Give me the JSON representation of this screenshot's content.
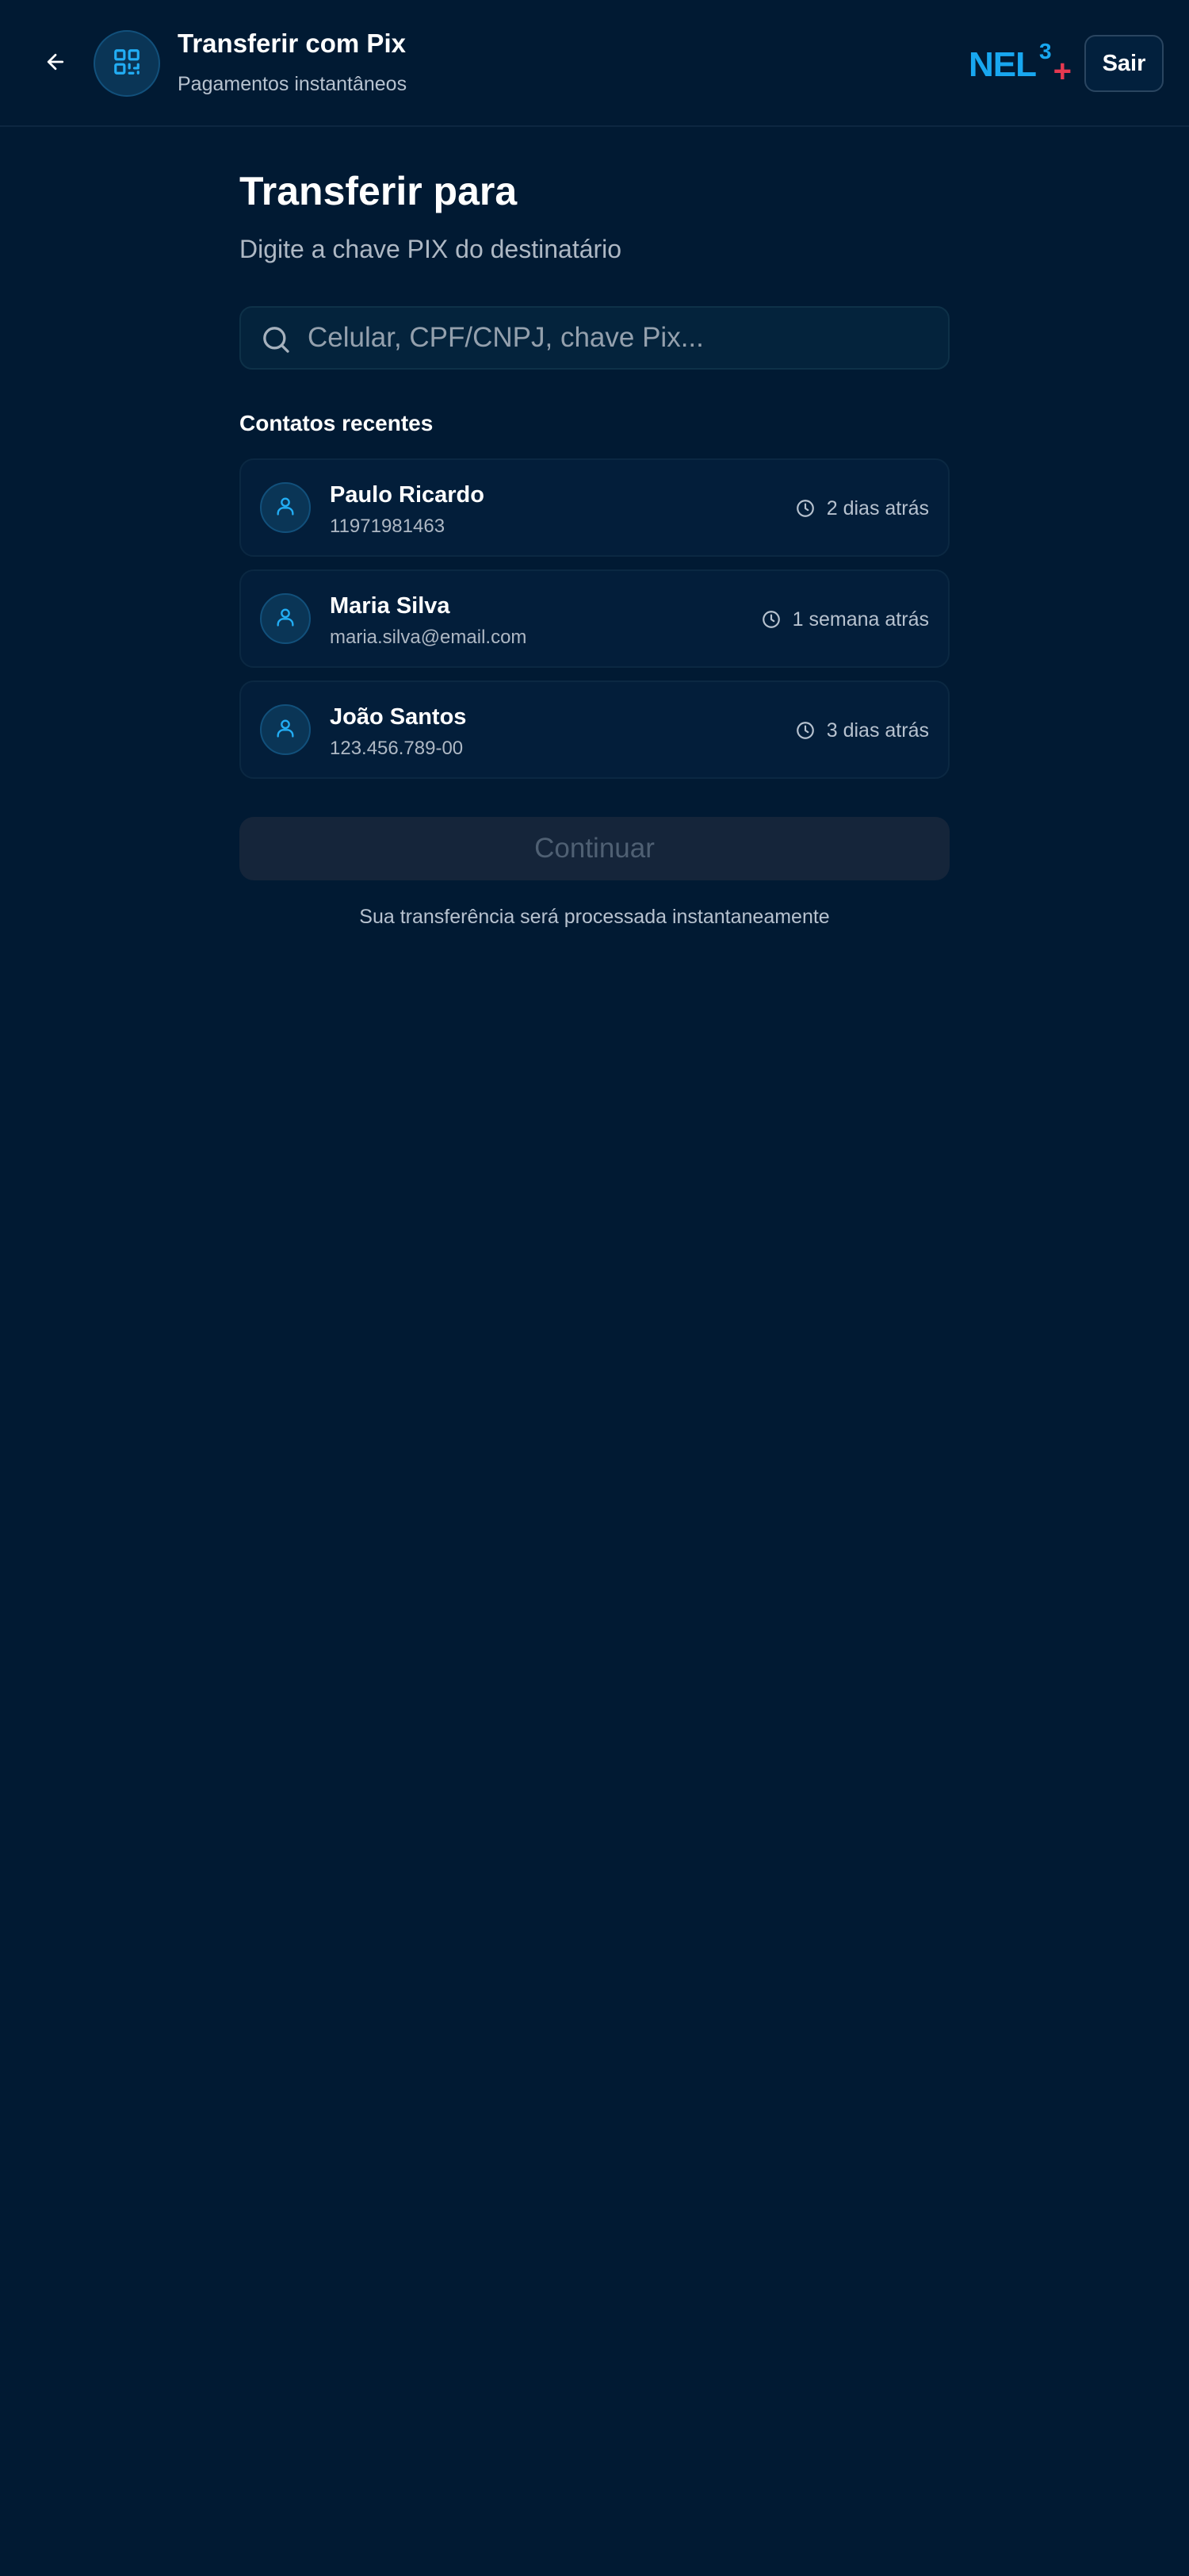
{
  "header": {
    "back_icon": "arrow-left-icon",
    "badge_icon": "qr-code-icon",
    "title": "Transferir com Pix",
    "subtitle": "Pagamentos instantâneos",
    "brand": {
      "name": "NEL",
      "superscript": "3",
      "plus": "+"
    },
    "exit_label": "Sair"
  },
  "main": {
    "heading": "Transferir para",
    "subheading": "Digite a chave PIX do destinatário",
    "search": {
      "icon": "search-icon",
      "value": "",
      "placeholder": "Celular, CPF/CNPJ, chave Pix..."
    },
    "recent_title": "Contatos recentes",
    "contacts": [
      {
        "name": "Paulo Ricardo",
        "key": "11971981463",
        "time": "2 dias atrás"
      },
      {
        "name": "Maria Silva",
        "key": "maria.silva@email.com",
        "time": "1 semana atrás"
      },
      {
        "name": "João Santos",
        "key": "123.456.789-00",
        "time": "3 dias atrás"
      }
    ],
    "continue_label": "Continuar",
    "footnote": "Sua transferência será processada instantaneamente"
  },
  "colors": {
    "background": "#011a33",
    "accent": "#18a7f0",
    "brand_plus": "#e63950",
    "card": "#031e3a",
    "button_disabled": "#15253a"
  }
}
